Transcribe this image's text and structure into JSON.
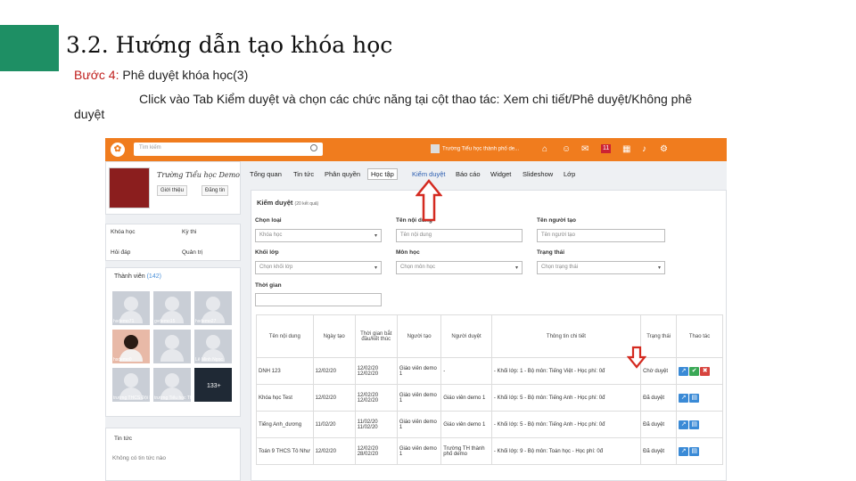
{
  "slide": {
    "title": "3.2. Hướng dẫn tạo khóa học",
    "step_label": "Bước 4:",
    "step_text": "Phê duyệt khóa học(3)",
    "instruction_line1": "Click vào Tab Kiểm duyệt và chọn các chức năng tại cột thao tác: Xem chi tiết/Phê duyệt/Không phê",
    "instruction_line2": "duyệt",
    "accent_color": "#1e8f64",
    "step_color": "#c0201e"
  },
  "screenshot": {
    "topbar": {
      "search_placeholder": "Tìm kiếm",
      "user_name": "Trường Tiểu học thành phố de...",
      "badge_count": "11",
      "color": "#f07c1e"
    },
    "profile": {
      "school_name": "Trường Tiểu học Demo",
      "intro_button": "Giới thiệu",
      "post_button": "Đăng tin"
    },
    "sidebar": {
      "items": [
        "Khóa học",
        "Kỳ thi",
        "Hỏi đáp",
        "Quản trị"
      ]
    },
    "members": {
      "title": "Thành viên",
      "count": "(142)",
      "tiles": [
        {
          "caption": "hsdemo71"
        },
        {
          "caption": "gvdemo15"
        },
        {
          "caption": "hsdemo27"
        },
        {
          "caption": "hsdemo0"
        },
        {
          "caption": ""
        },
        {
          "caption": "Lê Minh Ngọc"
        },
        {
          "caption": "trường THCS Đội Mỏ"
        },
        {
          "caption": "trường Tiểu học Thị Huân"
        },
        {
          "caption": "133+"
        }
      ]
    },
    "news": {
      "title": "Tin tức",
      "empty_text": "Không có tin tức nào"
    },
    "nav": {
      "tabs": [
        "Tổng quan",
        "Tin tức",
        "Phân quyền",
        "Học tập",
        "Kiểm duyệt",
        "Báo cáo",
        "Widget",
        "Slideshow",
        "Lớp"
      ],
      "active": "Kiểm duyệt"
    },
    "panel": {
      "title": "Kiểm duyệt",
      "subtitle": "(20 kết quả)",
      "filters": [
        {
          "label": "Chọn loại",
          "value": "Khóa học"
        },
        {
          "label": "Tên nội dung",
          "value": "Tên nội dung"
        },
        {
          "label": "Tên người tạo",
          "value": "Tên người tạo"
        },
        {
          "label": "Khối lớp",
          "value": "Chọn khối lớp"
        },
        {
          "label": "Môn học",
          "value": "Chọn môn học"
        },
        {
          "label": "Trạng thái",
          "value": "Chọn trạng thái"
        },
        {
          "label": "Thời gian",
          "value": ""
        }
      ],
      "columns": [
        "Tên nội dung",
        "Ngày tạo",
        "Thời gian bắt đầu/kết thúc",
        "Người tạo",
        "Người duyệt",
        "Thông tin chi tiết",
        "Trạng thái",
        "Thao tác"
      ],
      "rows": [
        {
          "name": "DNH 123",
          "created": "12/02/20",
          "period": "12/02/20 12/02/20",
          "creator": "Giáo viên demo 1",
          "approver": "-",
          "info": "- Khối lớp: 1 - Bộ môn: Tiếng Việt - Học phí: 0đ",
          "status": "Chờ duyệt",
          "actions": [
            "view",
            "approve",
            "reject"
          ]
        },
        {
          "name": "Khóa học Test",
          "created": "12/02/20",
          "period": "12/02/20 12/02/20",
          "creator": "Giáo viên demo 1",
          "approver": "Giáo viên demo 1",
          "info": "- Khối lớp: 5 - Bộ môn: Tiếng Anh - Học phí: 0đ",
          "status": "Đã duyệt",
          "actions": [
            "view",
            "detail"
          ]
        },
        {
          "name": "Tiếng Anh_dương",
          "created": "11/02/20",
          "period": "11/02/20 11/02/20",
          "creator": "Giáo viên demo 1",
          "approver": "Giáo viên demo 1",
          "info": "- Khối lớp: 5 - Bộ môn: Tiếng Anh - Học phí: 0đ",
          "status": "Đã duyệt",
          "actions": [
            "view",
            "detail"
          ]
        },
        {
          "name": "Toán 9 THCS Tô Như",
          "created": "12/02/20",
          "period": "12/02/20 28/02/20",
          "creator": "Giáo viên demo 1",
          "approver": "Trường TH thành phố demo",
          "info": "- Khối lớp: 9 - Bộ môn: Toán học - Học phí: 0đ",
          "status": "Đã duyệt",
          "actions": [
            "view",
            "detail"
          ]
        }
      ]
    }
  }
}
